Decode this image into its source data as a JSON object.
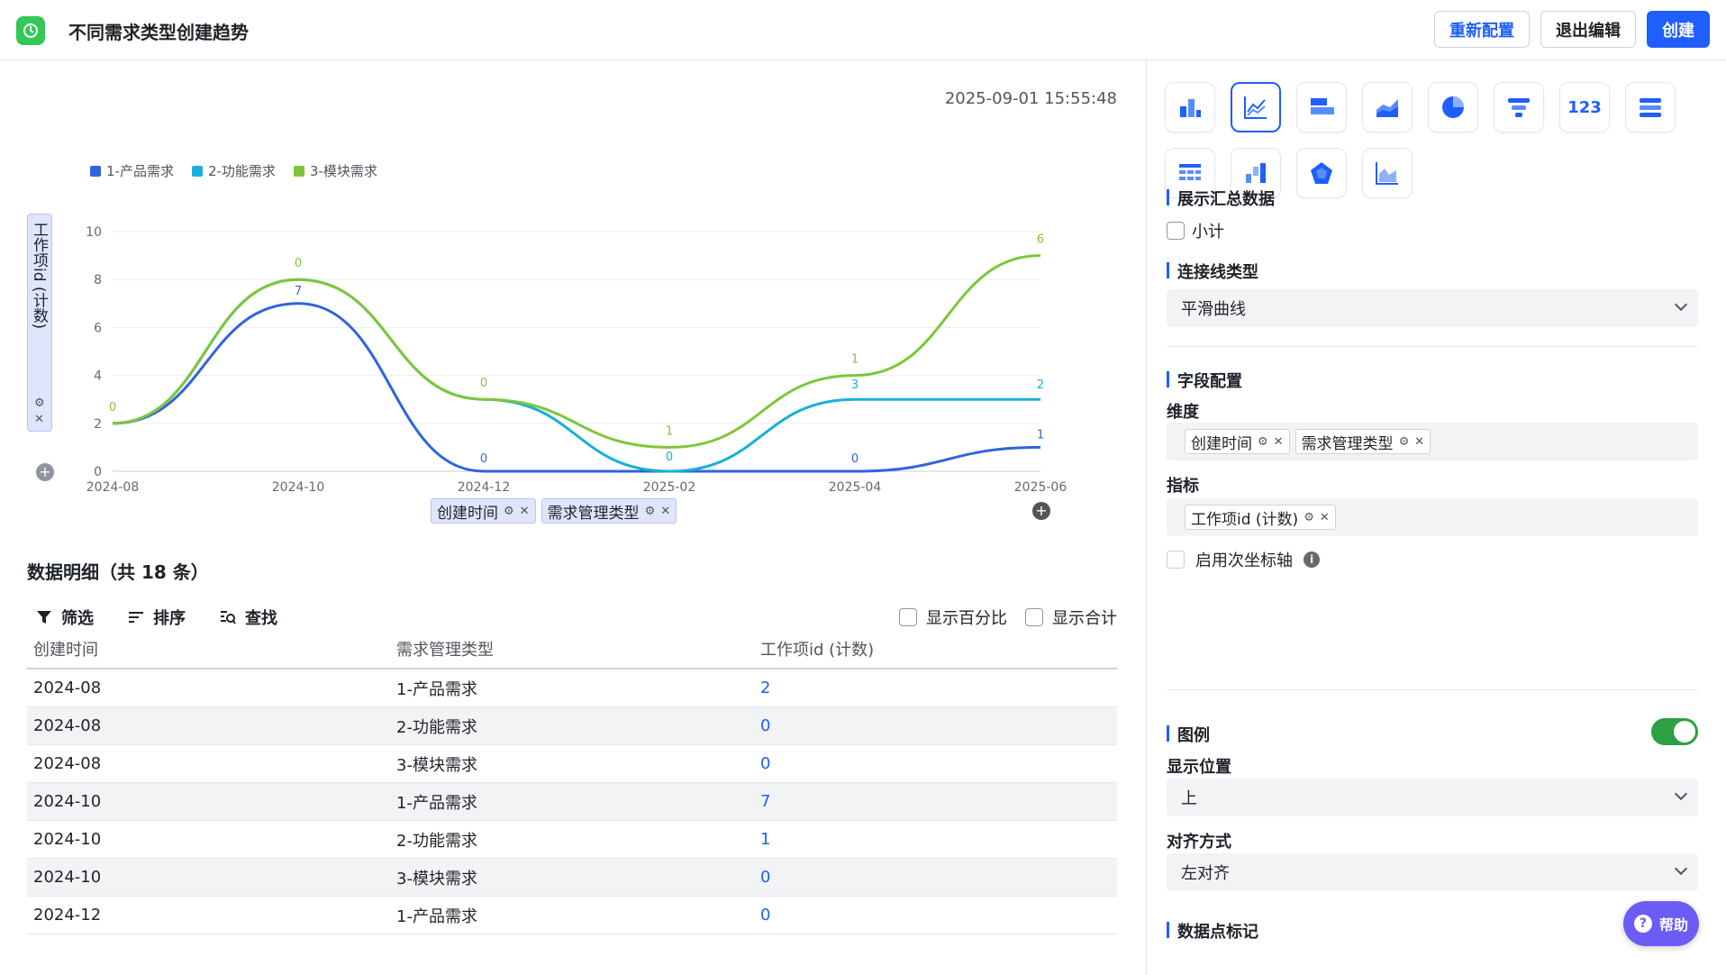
{
  "header": {
    "title": "不同需求类型创建趋势",
    "reconfigure": "重新配置",
    "exit_edit": "退出编辑",
    "create": "创建"
  },
  "main": {
    "timestamp": "2025-09-01 15:55:48",
    "y_axis_pill": "工作项id (计数)",
    "dimension_pills": [
      "创建时间",
      "需求管理类型"
    ],
    "detail_title": "数据明细（共 18 条）",
    "toolbar": {
      "filter": "筛选",
      "sort": "排序",
      "search": "查找"
    },
    "toggles": {
      "percent": "显示百分比",
      "total": "显示合计"
    },
    "table": {
      "columns": [
        "创建时间",
        "需求管理类型",
        "工作项id (计数)"
      ],
      "rows": [
        [
          "2024-08",
          "1-产品需求",
          "2"
        ],
        [
          "2024-08",
          "2-功能需求",
          "0"
        ],
        [
          "2024-08",
          "3-模块需求",
          "0"
        ],
        [
          "2024-10",
          "1-产品需求",
          "7"
        ],
        [
          "2024-10",
          "2-功能需求",
          "1"
        ],
        [
          "2024-10",
          "3-模块需求",
          "0"
        ],
        [
          "2024-12",
          "1-产品需求",
          "0"
        ]
      ]
    }
  },
  "chart_data": {
    "type": "line",
    "x": [
      "2024-08",
      "2024-10",
      "2024-12",
      "2025-02",
      "2025-04",
      "2025-06"
    ],
    "ylim": [
      0,
      10
    ],
    "yticks": [
      0,
      2,
      4,
      6,
      8,
      10
    ],
    "smooth": true,
    "legend_position": "top-left",
    "series": [
      {
        "name": "1-产品需求",
        "color": "#2f63e0",
        "values": [
          2,
          7,
          0,
          0,
          0,
          1
        ],
        "labels": [
          "",
          "7",
          "0",
          "",
          "0",
          "1"
        ]
      },
      {
        "name": "2-功能需求",
        "color": "#17b0d9",
        "values": [
          2,
          8,
          3,
          0,
          3,
          3
        ],
        "labels": [
          "",
          "",
          "",
          "0",
          "3",
          "2"
        ]
      },
      {
        "name": "3-模块需求",
        "color": "#7ec63a",
        "values": [
          2,
          8,
          3,
          1,
          4,
          9
        ],
        "labels": [
          "0",
          "0",
          "0",
          "1",
          "1",
          "6"
        ]
      }
    ]
  },
  "panel": {
    "chart_types": [
      "bar-chart-icon",
      "line-chart-icon",
      "horizontal-bar-icon",
      "area-chart-icon",
      "pie-chart-icon",
      "funnel-chart-icon",
      "number-card-icon",
      "list-chart-icon",
      "table-chart-icon",
      "waterfall-chart-icon",
      "radar-chart-icon",
      "combo-chart-icon"
    ],
    "number_card_label": "123",
    "summary_title": "展示汇总数据",
    "subtotal": "小计",
    "line_type_title": "连接线类型",
    "line_type_value": "平滑曲线",
    "field_config_title": "字段配置",
    "dimension_label": "维度",
    "dimensions": [
      "创建时间",
      "需求管理类型"
    ],
    "metric_label": "指标",
    "metrics": [
      "工作项id (计数)"
    ],
    "secondary_axis": "启用次坐标轴",
    "legend_title": "图例",
    "position_label": "显示位置",
    "position_value": "上",
    "align_label": "对齐方式",
    "align_value": "左对齐",
    "markers_title": "数据点标记",
    "help": "帮助"
  }
}
